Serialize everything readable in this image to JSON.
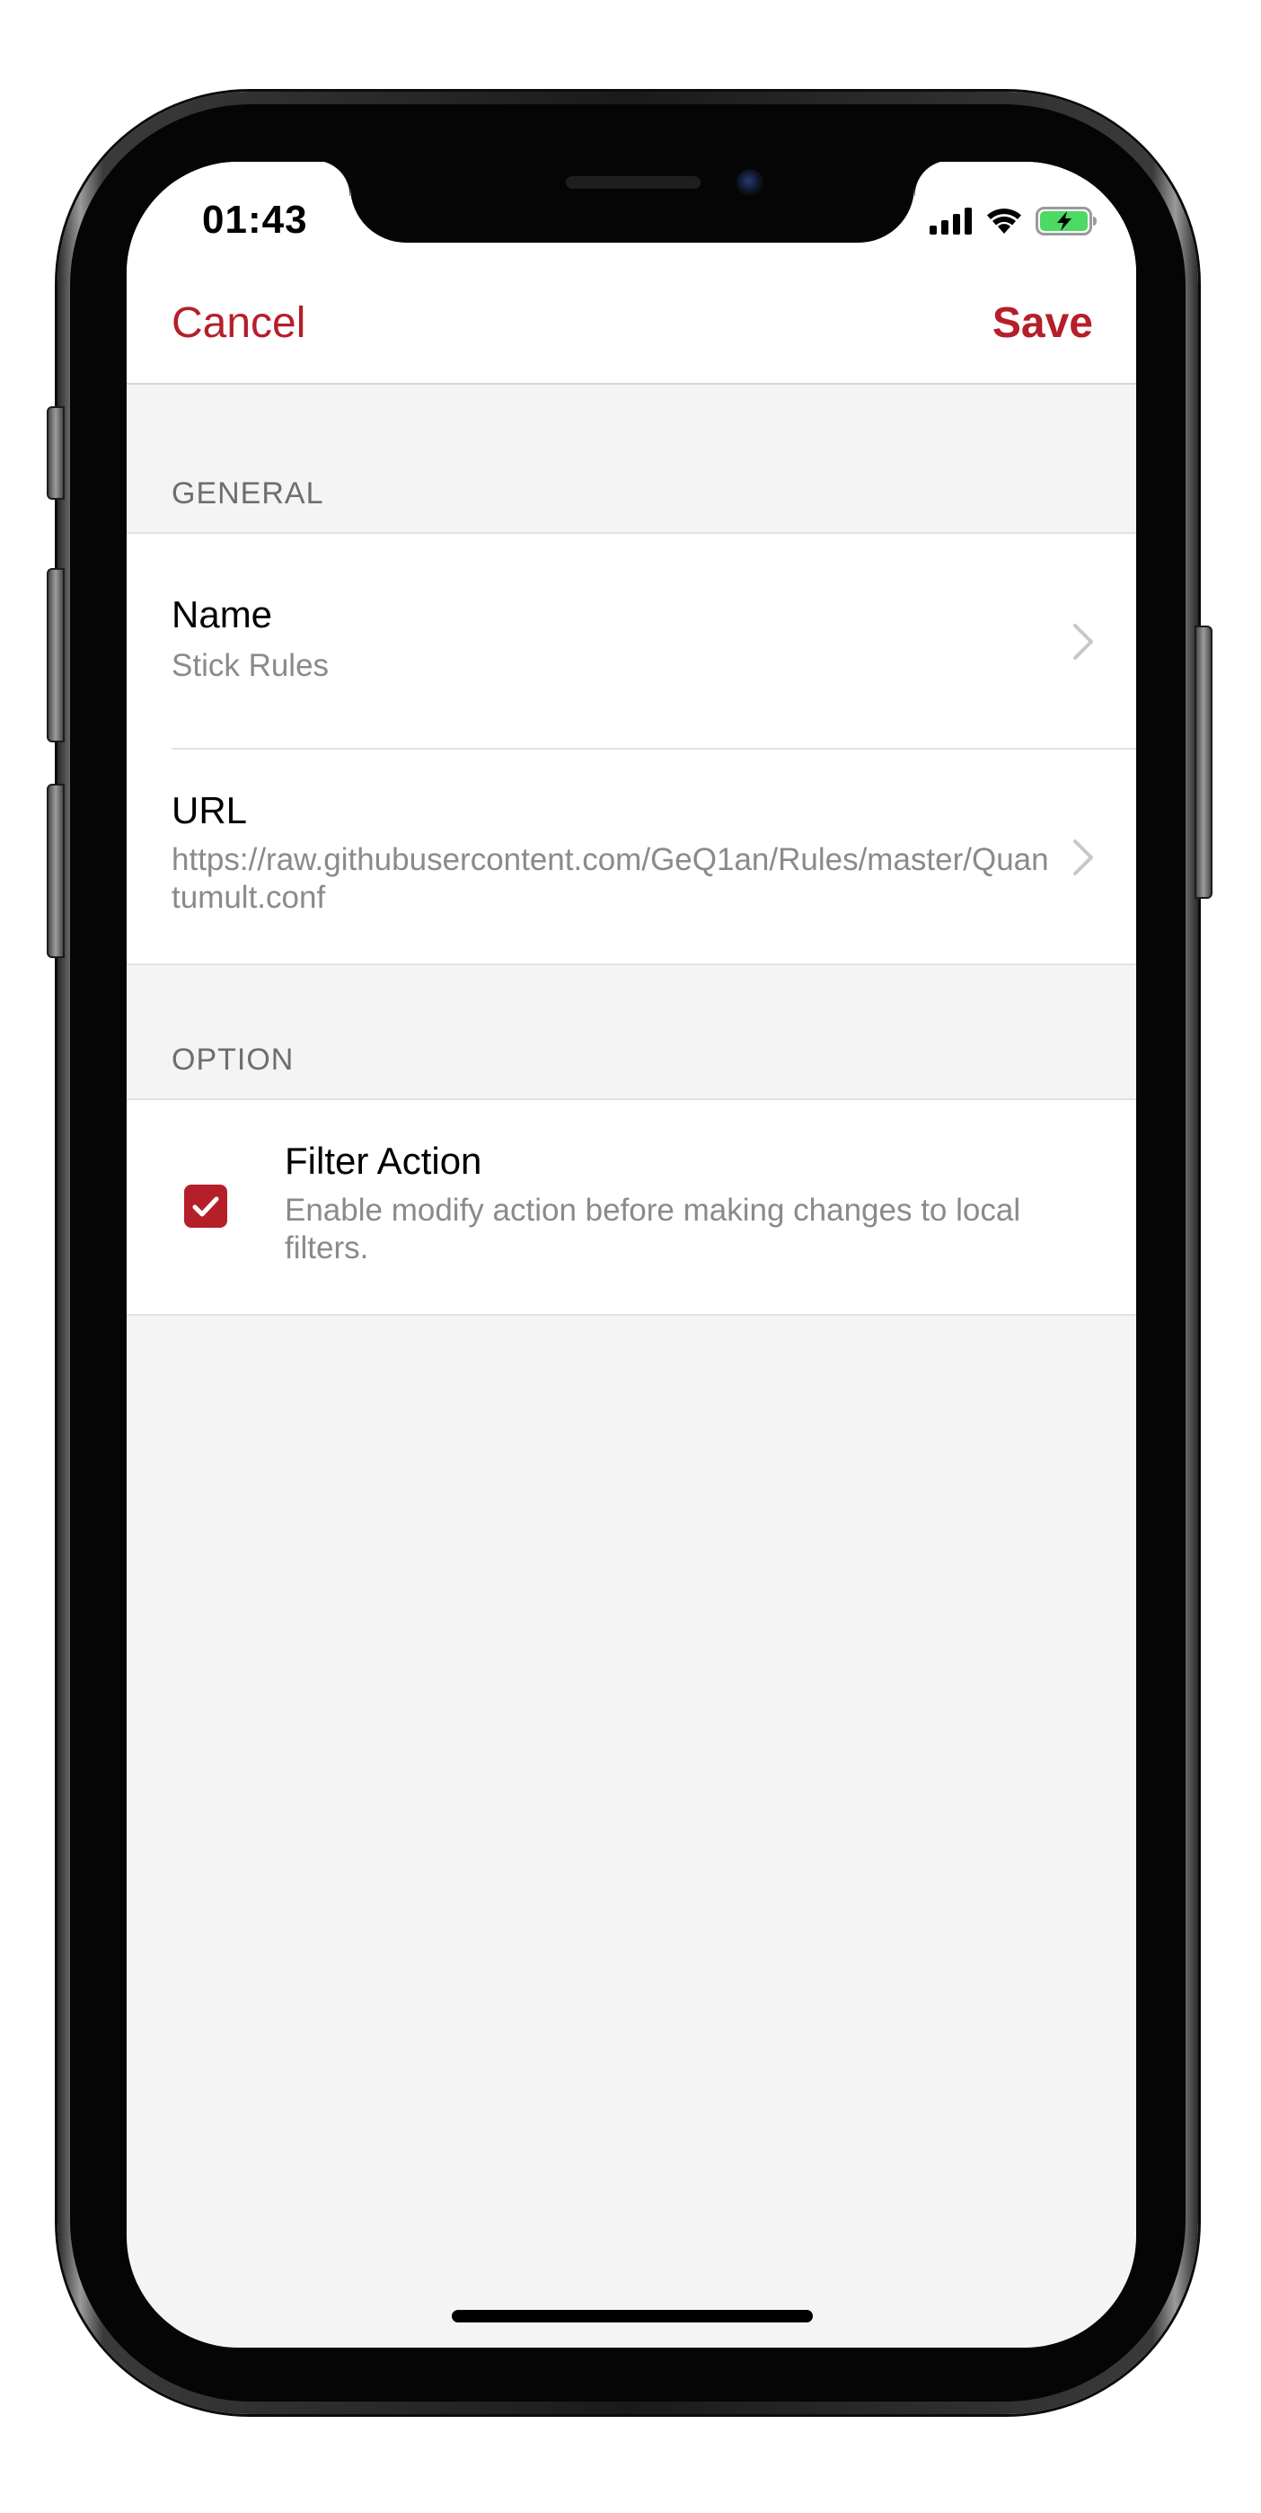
{
  "status_bar": {
    "time": "01:43"
  },
  "nav": {
    "cancel_label": "Cancel",
    "save_label": "Save"
  },
  "sections": {
    "general": {
      "header": "GENERAL",
      "rows": [
        {
          "title": "Name",
          "value": "Stick Rules"
        },
        {
          "title": "URL",
          "value": "https://raw.githubusercontent.com/GeQ1an/Rules/master/Quantumult.conf"
        }
      ]
    },
    "option": {
      "header": "OPTION",
      "rows": [
        {
          "title": "Filter Action",
          "description": "Enable modify action before making changes to local filters.",
          "checked": true
        }
      ]
    }
  },
  "colors": {
    "accent": "#b51f2a",
    "background": "#f4f4f4",
    "secondary_text": "#8a8a8e",
    "battery_fill": "#4cd964"
  },
  "icons": {
    "signal": "cellular-signal-icon",
    "wifi": "wifi-icon",
    "battery": "battery-charging-icon",
    "chevron": "chevron-right-icon",
    "checkbox": "checkmark-icon"
  }
}
